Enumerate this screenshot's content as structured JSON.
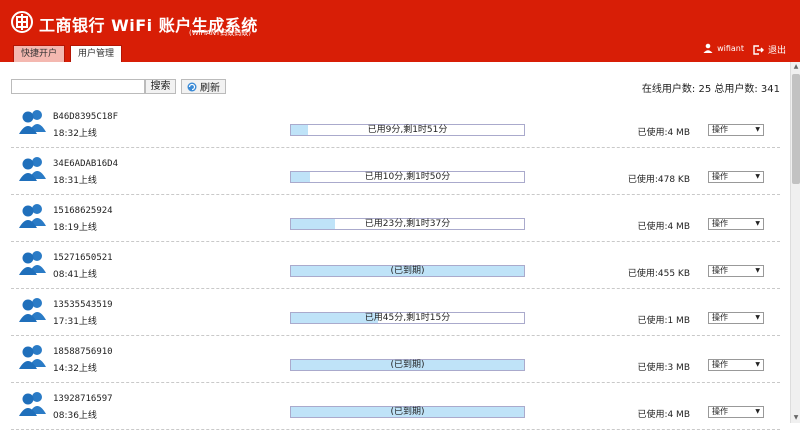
{
  "header": {
    "title": "工商银行 WiFi 账户生成系统",
    "subtitle": "(WiFiANT蚂蚁蚂蚁)",
    "tabs": [
      {
        "label": "快捷开户",
        "active": false
      },
      {
        "label": "用户管理",
        "active": true
      }
    ],
    "user_name": "wifiant",
    "logout_label": "退出",
    "bg_color": "#d81e06"
  },
  "toolbar": {
    "search_value": "",
    "search_label": "搜索",
    "refresh_label": "刷新",
    "stats": "在线用户数: 25 总用户数: 341"
  },
  "users": [
    {
      "name": "B46D8395C18F",
      "time": "18:32上线",
      "status": "已用9分,剩1时51分",
      "used_fraction": 0.075,
      "usage": "已使用:4 MB",
      "op": "操作"
    },
    {
      "name": "34E6ADAB16D4",
      "time": "18:31上线",
      "status": "已用10分,剩1时50分",
      "used_fraction": 0.083,
      "usage": "已使用:478 KB",
      "op": "操作"
    },
    {
      "name": "15168625924",
      "time": "18:19上线",
      "status": "已用23分,剩1时37分",
      "used_fraction": 0.19,
      "usage": "已使用:4 MB",
      "op": "操作"
    },
    {
      "name": "15271650521",
      "time": "08:41上线",
      "status": "(已到期)",
      "used_fraction": 1.0,
      "usage": "已使用:455 KB",
      "op": "操作"
    },
    {
      "name": "13535543519",
      "time": "17:31上线",
      "status": "已用45分,剩1时15分",
      "used_fraction": 0.375,
      "usage": "已使用:1 MB",
      "op": "操作"
    },
    {
      "name": "18588756910",
      "time": "14:32上线",
      "status": "(已到期)",
      "used_fraction": 1.0,
      "usage": "已使用:3 MB",
      "op": "操作"
    },
    {
      "name": "13928716597",
      "time": "08:36上线",
      "status": "(已到期)",
      "used_fraction": 1.0,
      "usage": "已使用:4 MB",
      "op": "操作"
    }
  ]
}
